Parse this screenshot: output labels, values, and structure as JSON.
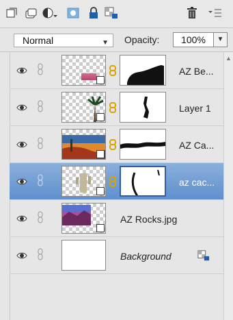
{
  "toolbar": {
    "icons": [
      "new-layer-icon",
      "new-group-icon",
      "adjustment-layer-icon",
      "layer-mask-icon",
      "lock-all-icon",
      "lock-transparent-icon",
      "trash-icon",
      "panel-menu-icon"
    ]
  },
  "blend": {
    "mode": "Normal",
    "opacity_label": "Opacity:",
    "opacity_value": "100%"
  },
  "layers": [
    {
      "name": "AZ Be...",
      "selected": false,
      "has_mask": true,
      "italic": false
    },
    {
      "name": "Layer 1",
      "selected": false,
      "has_mask": true,
      "italic": false
    },
    {
      "name": "AZ Ca...",
      "selected": false,
      "has_mask": true,
      "italic": false
    },
    {
      "name": "az cac...",
      "selected": true,
      "has_mask": true,
      "italic": false
    },
    {
      "name": "AZ Rocks.jpg",
      "selected": false,
      "has_mask": false,
      "italic": false
    },
    {
      "name": "Background",
      "selected": false,
      "has_mask": false,
      "italic": true
    }
  ],
  "colors": {
    "selection": "#6a98d2",
    "panel": "#e6e6e6"
  }
}
